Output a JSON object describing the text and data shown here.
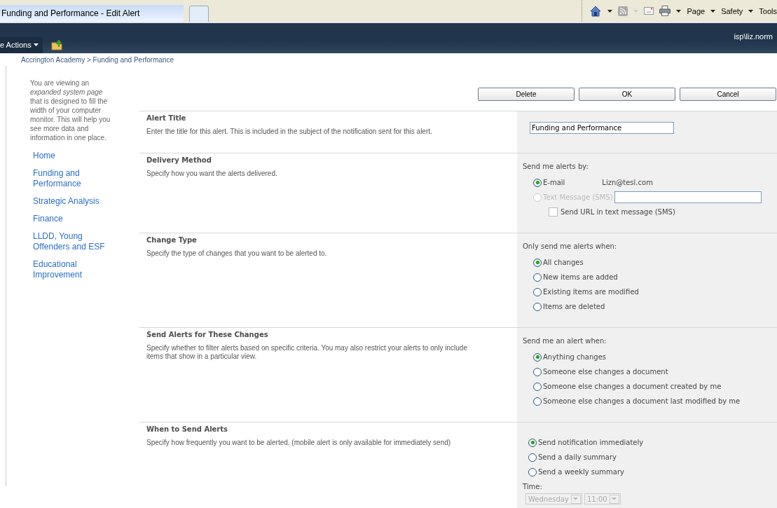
{
  "browser": {
    "tab_title": "Funding and Performance - Edit Alert",
    "commands": [
      "Page",
      "Safety",
      "Tools"
    ]
  },
  "top_bar": {
    "site_actions": "e Actions",
    "user": "isp\\liz.norm"
  },
  "breadcrumb": "Accrington Academy > Funding and Performance",
  "sidebar": {
    "note": "You are viewing an *expanded system page* that is designed to fill the width of your computer monitor. This will help you see more data and information in one place.",
    "items": [
      "Home",
      "Funding and Performance",
      "Strategic Analysis",
      "Finance",
      "LLDD, Young Offenders and ESF",
      "Educational Improvement"
    ]
  },
  "buttons": [
    "Delete",
    "OK",
    "Cancel"
  ],
  "sections": [
    {
      "kind": "title",
      "title": "Alert Title",
      "description": "Enter the title for this alert. This is included in the subject of the notification sent for this alert.",
      "value": "Funding and Performance"
    },
    {
      "kind": "delivery",
      "title": "Delivery Method",
      "description": "Specify how you want the alerts delivered.",
      "label": "Send me alerts by:",
      "options": [
        {
          "label": "E-mail",
          "selected": true,
          "disabled": false,
          "address": "Lizn@tesl.com"
        },
        {
          "label": "Text Message (SMS)",
          "selected": false,
          "disabled": true
        }
      ],
      "checkbox": {
        "label": "Send URL in text message (SMS)",
        "checked": false
      }
    },
    {
      "kind": "choice",
      "title": "Change Type",
      "description": "Specify the type of changes that you want to be alerted to.",
      "label": "Only send me alerts when:",
      "options": [
        {
          "label": "All changes",
          "selected": true
        },
        {
          "label": "New items are added",
          "selected": false
        },
        {
          "label": "Existing items are modified",
          "selected": false
        },
        {
          "label": "Items are deleted",
          "selected": false
        }
      ]
    },
    {
      "kind": "choice",
      "title": "Send Alerts for These Changes",
      "description": "Specify whether to filter alerts based on specific criteria. You may also restrict your alerts to only include items that show in a particular view.",
      "label": "Send me an alert when:",
      "options": [
        {
          "label": "Anything changes",
          "selected": true
        },
        {
          "label": "Someone else changes a document",
          "selected": false
        },
        {
          "label": "Someone else changes a document created by me",
          "selected": false
        },
        {
          "label": "Someone else changes a document last modified by me",
          "selected": false
        }
      ]
    },
    {
      "kind": "schedule",
      "title": "When to Send Alerts",
      "description": "Specify how frequently you want to be alerted. (mobile alert is only available for immediately send)",
      "options": [
        {
          "label": "Send notification immediately",
          "selected": true
        },
        {
          "label": "Send a daily summary",
          "selected": false
        },
        {
          "label": "Send a weekly summary",
          "selected": false
        }
      ],
      "time_label": "Time:",
      "day": "Wednesday",
      "hour": "11:00",
      "time_disabled": true
    }
  ]
}
